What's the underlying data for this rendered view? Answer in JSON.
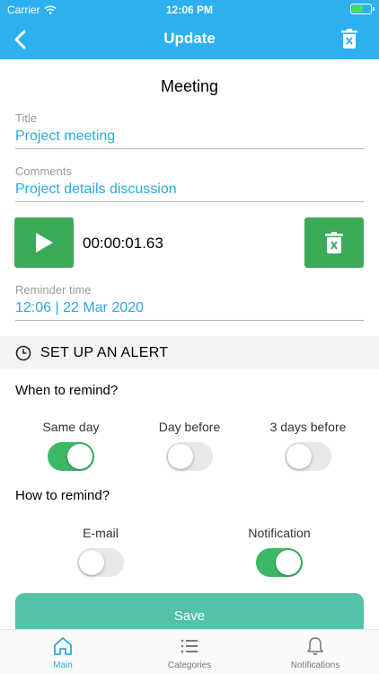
{
  "status": {
    "carrier": "Carrier",
    "time": "12:06 PM"
  },
  "nav": {
    "title": "Update",
    "back_icon": "chevron-left-icon",
    "delete_icon": "trash-icon"
  },
  "form": {
    "heading": "Meeting",
    "title_label": "Title",
    "title_value": "Project meeting",
    "comments_label": "Comments",
    "comments_value": "Project details discussion",
    "recording_duration": "00:00:01.63",
    "reminder_label": "Reminder time",
    "reminder_value": "12:06 | 22 Mar 2020"
  },
  "alert": {
    "header": "SET UP AN ALERT",
    "when_label": "When to remind?",
    "when_options": [
      {
        "label": "Same day",
        "on": true
      },
      {
        "label": "Day before",
        "on": false
      },
      {
        "label": "3 days before",
        "on": false
      }
    ],
    "how_label": "How to remind?",
    "how_options": [
      {
        "label": "E-mail",
        "on": false
      },
      {
        "label": "Notification",
        "on": true
      }
    ]
  },
  "save_label": "Save",
  "tabs": [
    {
      "label": "Main",
      "icon": "home-icon",
      "active": true
    },
    {
      "label": "Categories",
      "icon": "list-icon",
      "active": false
    },
    {
      "label": "Notifications",
      "icon": "bell-icon",
      "active": false
    }
  ],
  "colors": {
    "accent": "#2cb0f0",
    "green": "#3cab58",
    "save": "#52c2a9"
  }
}
